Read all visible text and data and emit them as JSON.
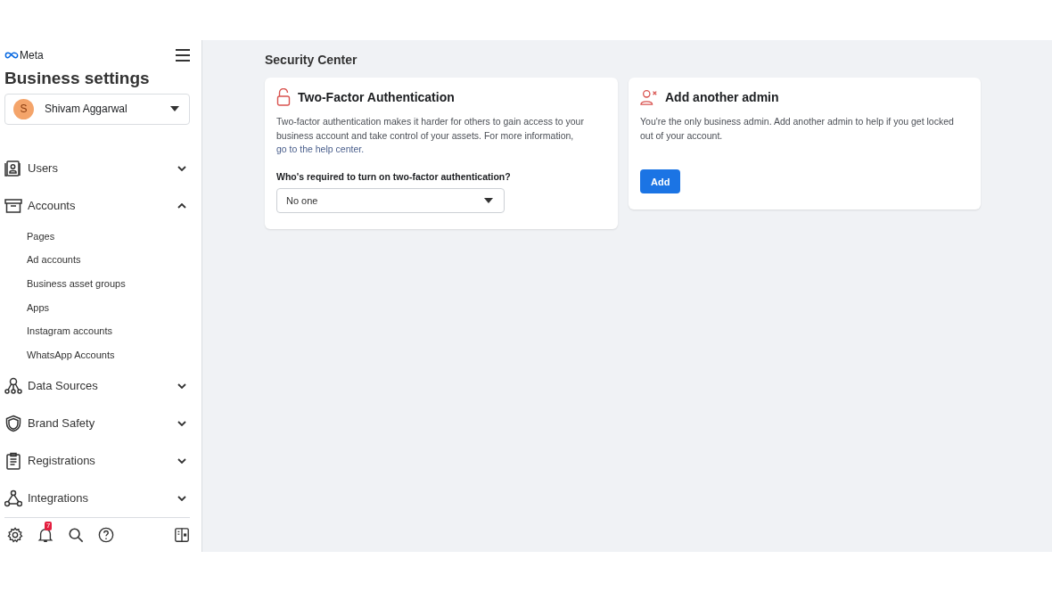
{
  "sidebar": {
    "logo": "Meta",
    "title": "Business settings",
    "account": {
      "initial": "S",
      "name": "Shivam Aggarwal"
    },
    "items": [
      {
        "label": "Users",
        "expanded": false
      },
      {
        "label": "Accounts",
        "expanded": true,
        "children": [
          {
            "label": "Pages"
          },
          {
            "label": "Ad accounts"
          },
          {
            "label": "Business asset groups"
          },
          {
            "label": "Apps"
          },
          {
            "label": "Instagram accounts"
          },
          {
            "label": "WhatsApp Accounts"
          }
        ]
      },
      {
        "label": "Data Sources",
        "expanded": false
      },
      {
        "label": "Brand Safety",
        "expanded": false
      },
      {
        "label": "Registrations",
        "expanded": false
      },
      {
        "label": "Integrations",
        "expanded": false
      }
    ],
    "notification_count": "7"
  },
  "main": {
    "title": "Security Center",
    "two_factor": {
      "title": "Two-Factor Authentication",
      "text": "Two-factor authentication makes it harder for others to gain access to your business account and take control of your assets. For more information, ",
      "link": "go to the help center.",
      "question": "Who's required to turn on two-factor authentication?",
      "value": "No one"
    },
    "admin": {
      "title": "Add another admin",
      "text": "You're the only business admin. Add another admin to help if you get locked out of your account.",
      "button": "Add"
    }
  }
}
